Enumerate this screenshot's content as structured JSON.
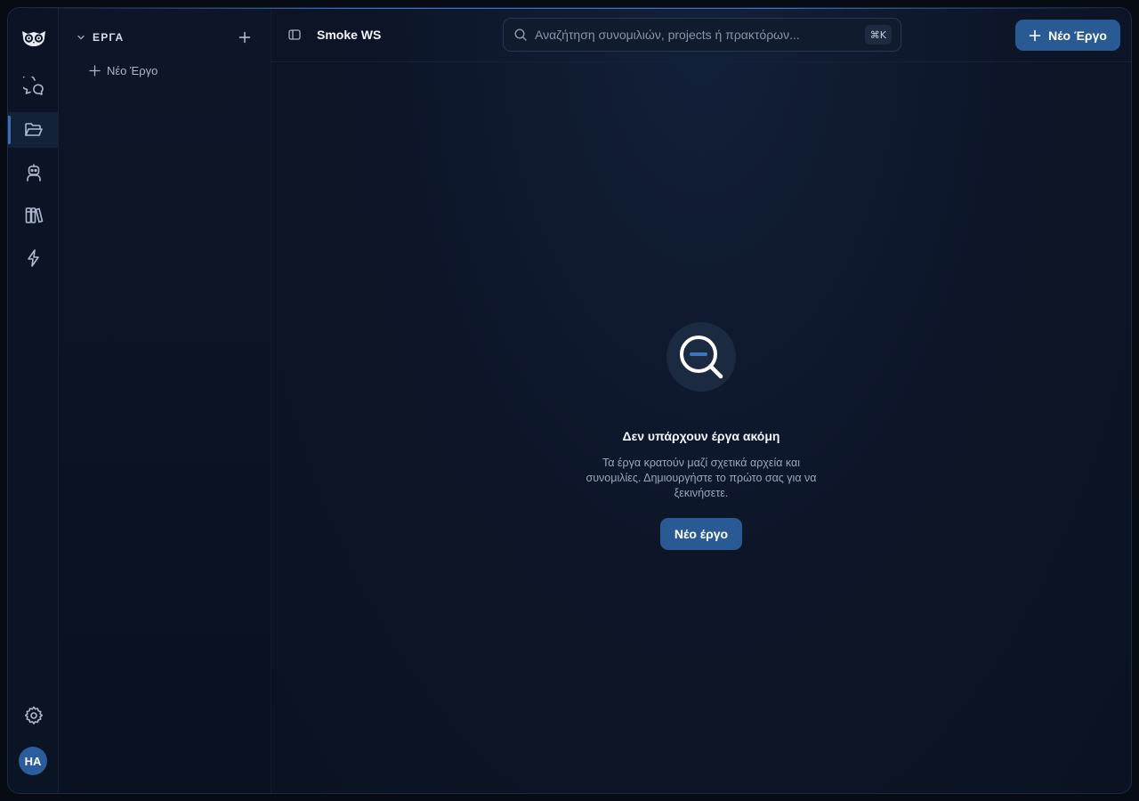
{
  "rail": {
    "items": [
      {
        "name": "chats",
        "icon": "chat-bubbles-icon"
      },
      {
        "name": "projects",
        "icon": "folder-open-icon",
        "active": true
      },
      {
        "name": "agents",
        "icon": "robot-icon"
      },
      {
        "name": "library",
        "icon": "books-icon"
      },
      {
        "name": "automations",
        "icon": "lightning-icon"
      }
    ],
    "settings_icon": "gear-icon",
    "avatar_initials": "HA"
  },
  "sidebar": {
    "section_title": "ΕΡΓΑ",
    "new_item_label": "Νέο Έργο"
  },
  "topbar": {
    "workspace_name": "Smoke WS",
    "search_placeholder": "Αναζήτηση συνομιλιών, projects ή πρακτόρων...",
    "search_shortcut": "⌘K",
    "new_button_label": "Νέο Έργο"
  },
  "empty_state": {
    "title": "Δεν υπάρχουν έργα ακόμη",
    "description": "Τα έργα κρατούν μαζί σχετικά αρχεία και συνομιλίες. Δημιουργήστε το πρώτο σας για να ξεκινήσετε.",
    "button_label": "Νέο έργο"
  },
  "colors": {
    "accent": "#2a5a93",
    "background": "#0c1527",
    "rail_active": "#3b6fb8"
  }
}
